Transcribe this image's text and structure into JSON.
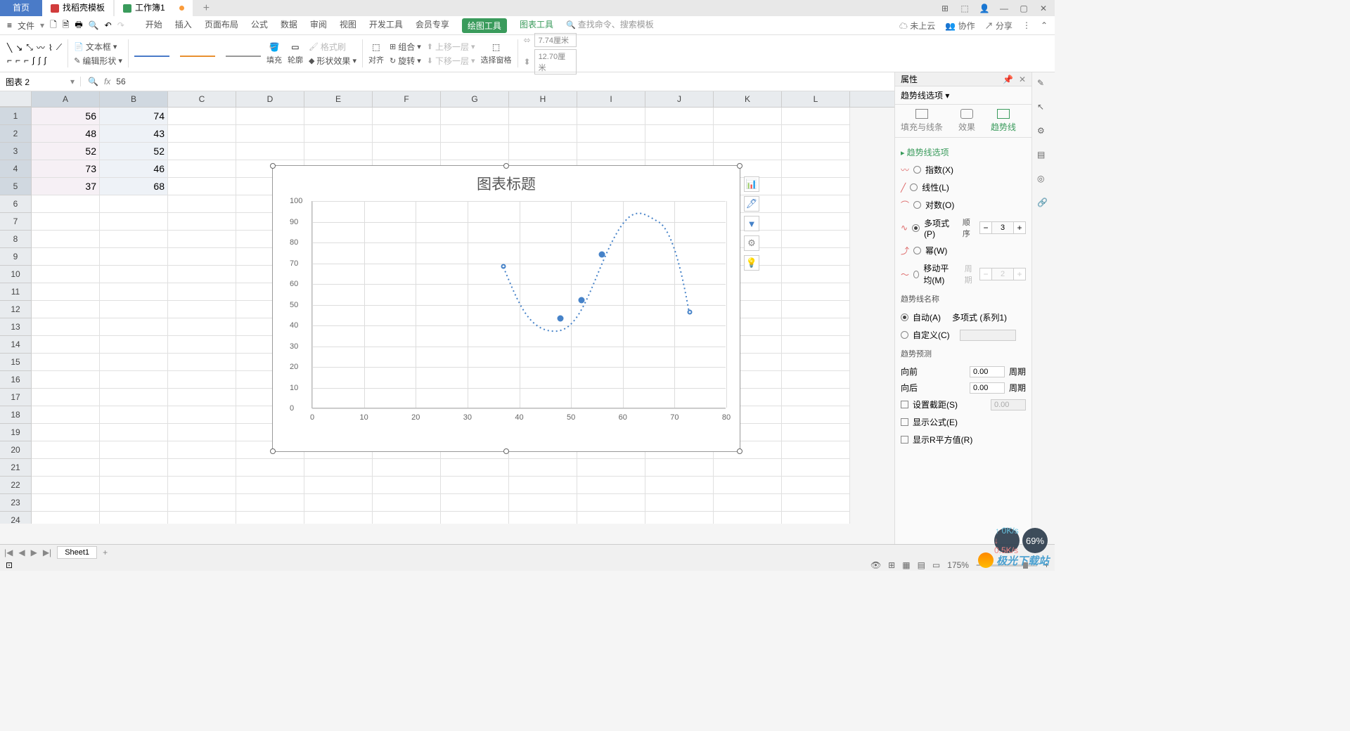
{
  "title_bar": {
    "home_tab": "首页",
    "app_tab": "找稻壳模板",
    "doc_tab": "工作簿1"
  },
  "menu": {
    "file": "文件",
    "items": [
      "开始",
      "插入",
      "页面布局",
      "公式",
      "数据",
      "审阅",
      "视图",
      "开发工具",
      "会员专享"
    ],
    "active": "绘图工具",
    "extra": "图表工具",
    "search_hint": "查找命令、搜索模板",
    "cloud": "未上云",
    "coop": "协作",
    "share": "分享"
  },
  "ribbon": {
    "textbox": "文本框",
    "editshape": "编辑形状",
    "fill": "填充",
    "outline": "轮廓",
    "fx": "形状效果",
    "fmtpaint": "格式刷",
    "align": "对齐",
    "group": "组合",
    "rotate": "旋转",
    "moveup": "上移一层",
    "movedown": "下移一层",
    "selpane": "选择窗格",
    "w": "7.74厘米",
    "h": "12.70厘米"
  },
  "name_box": "图表 2",
  "formula": "56",
  "columns": [
    "A",
    "B",
    "C",
    "D",
    "E",
    "F",
    "G",
    "H",
    "I",
    "J",
    "K",
    "L"
  ],
  "rows": [
    "1",
    "2",
    "3",
    "4",
    "5",
    "6",
    "7",
    "8",
    "9",
    "10",
    "11",
    "12",
    "13",
    "14",
    "15",
    "16",
    "17",
    "18",
    "19",
    "20",
    "21",
    "22",
    "23",
    "24"
  ],
  "data_a": [
    "56",
    "48",
    "52",
    "73",
    "37"
  ],
  "data_b": [
    "74",
    "43",
    "52",
    "46",
    "68"
  ],
  "chart_data": {
    "type": "scatter",
    "title": "图表标题",
    "xlim": [
      0,
      80
    ],
    "ylim": [
      0,
      100
    ],
    "xticks": [
      0,
      10,
      20,
      30,
      40,
      50,
      60,
      70,
      80
    ],
    "yticks": [
      0,
      10,
      20,
      30,
      40,
      50,
      60,
      70,
      80,
      90,
      100
    ],
    "series": [
      {
        "name": "系列1",
        "x": [
          37,
          48,
          52,
          56,
          73
        ],
        "y": [
          68,
          43,
          52,
          74,
          46
        ]
      }
    ],
    "trendline": {
      "type": "polynomial",
      "order": 3
    }
  },
  "props": {
    "header": "属性",
    "dropdown": "趋势线选项",
    "tab1": "填充与线条",
    "tab2": "效果",
    "tab3": "趋势线",
    "section": "趋势线选项",
    "opt_exp": "指数(X)",
    "opt_lin": "线性(L)",
    "opt_log": "对数(O)",
    "opt_poly": "多项式(P)",
    "opt_power": "幂(W)",
    "opt_ma": "移动平均(M)",
    "order_label": "顺序",
    "order_val": "3",
    "period_label": "周期",
    "period_val": "2",
    "name_section": "趋势线名称",
    "auto": "自动(A)",
    "auto_val": "多项式 (系列1)",
    "custom": "自定义(C)",
    "forecast_section": "趋势预测",
    "forward": "向前",
    "backward": "向后",
    "fwd_val": "0.00",
    "bwd_val": "0.00",
    "period_unit": "周期",
    "intercept": "设置截距(S)",
    "intercept_val": "0.00",
    "show_eq": "显示公式(E)",
    "show_r2": "显示R平方值(R)"
  },
  "sheet": {
    "name": "Sheet1"
  },
  "status": {
    "zoom": "175%",
    "net_up": "0K/s",
    "net_down": "0.5K/s",
    "cpu": "69%"
  },
  "watermark": "极光下载站"
}
